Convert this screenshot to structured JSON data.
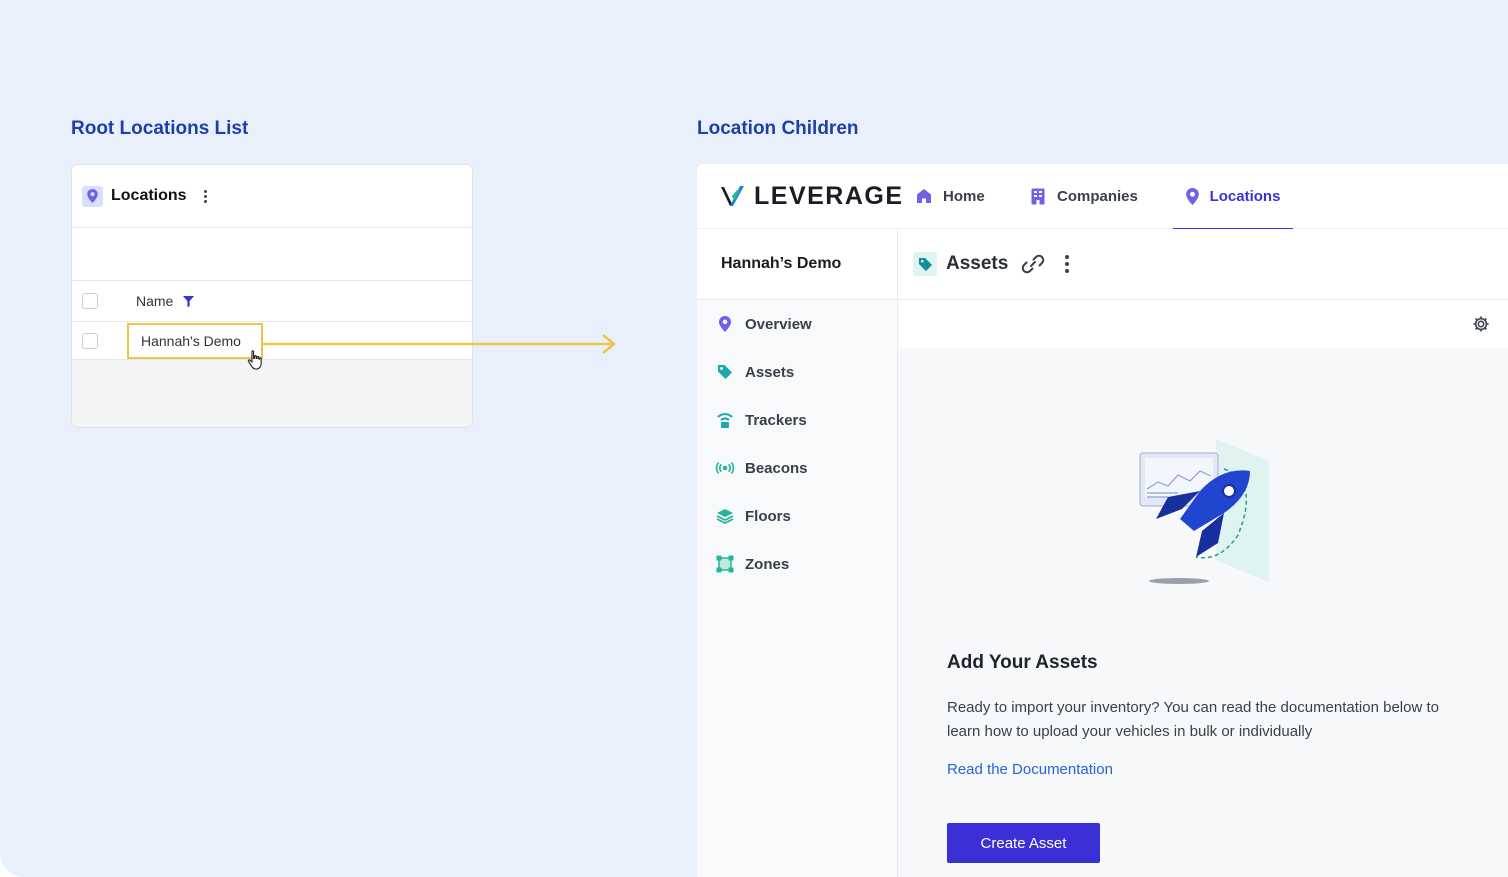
{
  "left_section": {
    "title": "Root Locations List",
    "panel": {
      "title": "Locations",
      "column_header": "Name",
      "rows": [
        "Hannah's Demo"
      ]
    }
  },
  "right_section": {
    "title": "Location Children",
    "brand": "LEVERAGE",
    "nav": [
      {
        "label": "Home",
        "icon": "home-icon"
      },
      {
        "label": "Companies",
        "icon": "building-icon"
      },
      {
        "label": "Locations",
        "icon": "location-pin-icon",
        "active": true
      }
    ],
    "sidebar": {
      "location_name": "Hannah’s Demo",
      "items": [
        {
          "label": "Overview",
          "icon": "location-pin-icon"
        },
        {
          "label": "Assets",
          "icon": "tag-icon"
        },
        {
          "label": "Trackers",
          "icon": "tracker-icon"
        },
        {
          "label": "Beacons",
          "icon": "beacon-icon"
        },
        {
          "label": "Floors",
          "icon": "layers-icon"
        },
        {
          "label": "Zones",
          "icon": "zone-icon"
        }
      ]
    },
    "main": {
      "title": "Assets",
      "empty_state": {
        "title": "Add Your Assets",
        "description": "Ready to import your inventory? You can read the documentation below to learn how to upload your vehicles in bulk or individually",
        "link_label": "Read the Documentation",
        "button_label": "Create Asset"
      }
    }
  },
  "colors": {
    "background": "#eaf0fb",
    "section_title": "#1f3fa8",
    "accent": "#3b32d6",
    "highlight": "#ecc54a",
    "link": "#2563d6"
  }
}
